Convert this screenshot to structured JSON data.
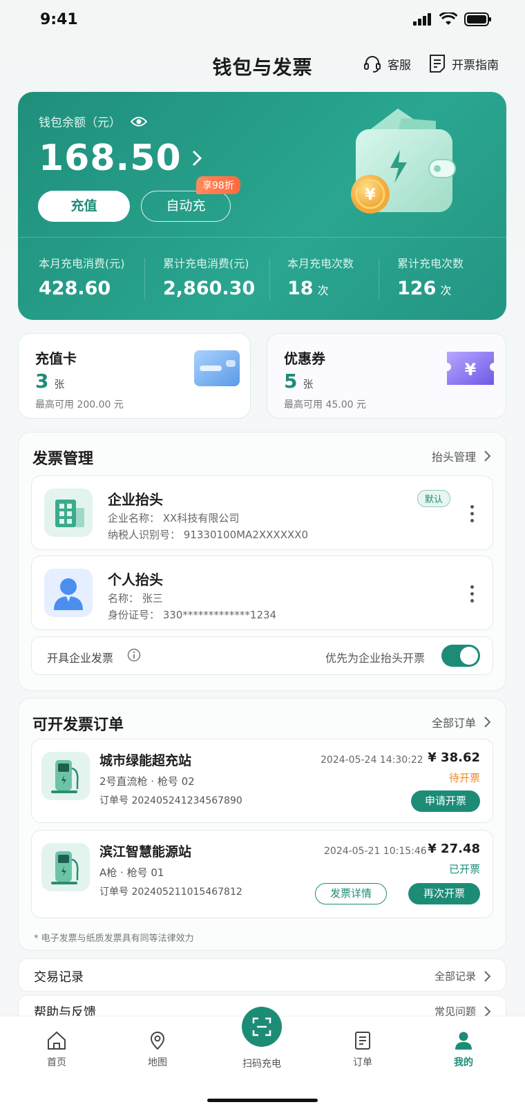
{
  "status_bar": {
    "time": "9:41"
  },
  "header": {
    "title": "钱包与发票",
    "service_label": "客服",
    "guide_label": "开票指南"
  },
  "wallet": {
    "balance_label": "钱包余额（元）",
    "balance": "168.50",
    "recharge_label": "充值",
    "auto_label": "自动充",
    "discount_badge": "享98折",
    "stats": [
      {
        "label": "本月充电消费(元)",
        "value": "428.60",
        "unit": ""
      },
      {
        "label": "累计充电消费(元)",
        "value": "2,860.30",
        "unit": ""
      },
      {
        "label": "本月充电次数",
        "value": "18",
        "unit": "次"
      },
      {
        "label": "累计充电次数",
        "value": "126",
        "unit": "次"
      }
    ]
  },
  "cards": {
    "recharge_card": {
      "title": "充值卡",
      "count": "3",
      "unit": "张",
      "sub": "最高可用 200.00 元"
    },
    "coupon": {
      "title": "优惠券",
      "count": "5",
      "unit": "张",
      "sub": "最高可用 45.00 元"
    }
  },
  "invoice_mgmt": {
    "title": "发票管理",
    "link": "抬头管理",
    "headers": [
      {
        "title": "企业抬头",
        "badge": "默认",
        "line1": "企业名称：  XX科技有限公司",
        "line2": "纳税人识别号：  91330100MA2XXXXXX0"
      },
      {
        "title": "个人抬头",
        "line1": "名称：  张三",
        "line2": "身份证号：  330*************1234"
      }
    ],
    "toggle_label": "开具企业发票",
    "toggle_desc": "优先为企业抬头开票"
  },
  "orders": {
    "title": "可开发票订单",
    "link": "全部订单",
    "items": [
      {
        "station": "城市绿能超充站",
        "gun": "2号直流枪  ·  枪号  02",
        "order_no": "订单号  202405241234567890",
        "datetime": "2024-05-24  14:30:22",
        "amount": "¥ 38.62",
        "status": "待开票",
        "action": "申请开票"
      },
      {
        "station": "滨江智慧能源站",
        "gun": "A枪  ·  枪号  01",
        "order_no": "订单号  202405211015467812",
        "datetime": "2024-05-21  10:15:46",
        "amount": "¥ 27.48",
        "status": "已开票",
        "action_secondary": "发票详情",
        "action": "再次开票"
      }
    ],
    "note": "* 电子发票与纸质发票具有同等法律效力"
  },
  "rows": [
    {
      "title": "交易记录",
      "link": "全部记录"
    },
    {
      "title": "帮助与反馈",
      "link": "常见问题"
    }
  ],
  "tabbar": {
    "items": [
      "首页",
      "地图",
      "扫码充电",
      "订单",
      "我的"
    ],
    "active": "我的"
  },
  "colors": {
    "primary": "#1d8c77",
    "pending": "#f08a24",
    "done": "#1d8c77"
  }
}
